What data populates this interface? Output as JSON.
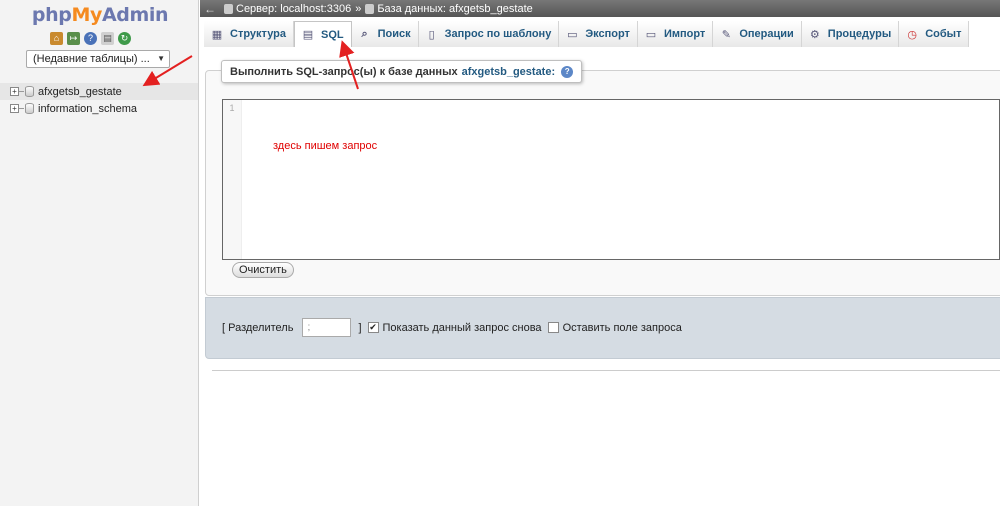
{
  "nav": {
    "logo": {
      "php": "php",
      "my": "My",
      "admin": "Admin"
    },
    "icons": [
      "home-icon",
      "logout-icon",
      "help-icon",
      "docs-icon",
      "reload-icon"
    ],
    "recent_tables": "(Недавние таблицы) ...",
    "databases": [
      {
        "name": "afxgetsb_gestate",
        "active": true
      },
      {
        "name": "information_schema",
        "active": false
      }
    ]
  },
  "breadcrumb": {
    "server": "Сервер: localhost:3306",
    "separator": "»",
    "database": "База данных: afxgetsb_gestate"
  },
  "tabs": [
    {
      "label": "Структура",
      "icon": "structure-icon",
      "active": false
    },
    {
      "label": "SQL",
      "icon": "sql-icon",
      "active": true
    },
    {
      "label": "Поиск",
      "icon": "search-icon",
      "active": false
    },
    {
      "label": "Запрос по шаблону",
      "icon": "query-icon",
      "active": false
    },
    {
      "label": "Экспорт",
      "icon": "export-icon",
      "active": false
    },
    {
      "label": "Импорт",
      "icon": "import-icon",
      "active": false
    },
    {
      "label": "Операции",
      "icon": "wrench-icon",
      "active": false
    },
    {
      "label": "Процедуры",
      "icon": "routines-icon",
      "active": false
    },
    {
      "label": "Событ",
      "icon": "events-icon",
      "active": false
    }
  ],
  "sql_panel": {
    "legend": "Выполнить SQL-запрос(ы) к базе данных",
    "database": "afxgetsb_gestate:",
    "line_number": "1",
    "hint": "здесь пишем запрос",
    "clear_label": "Очистить"
  },
  "options": {
    "delimiter_label": "[ Разделитель",
    "delimiter_value": ";",
    "close_bracket": "]",
    "show_query_label": "Показать данный запрос снова",
    "show_query_checked": true,
    "retain_box_label": "Оставить поле запроса",
    "retain_box_checked": false
  },
  "colors": {
    "annotation": "#e32020",
    "link": "#235a81",
    "topbar": "#666666"
  }
}
